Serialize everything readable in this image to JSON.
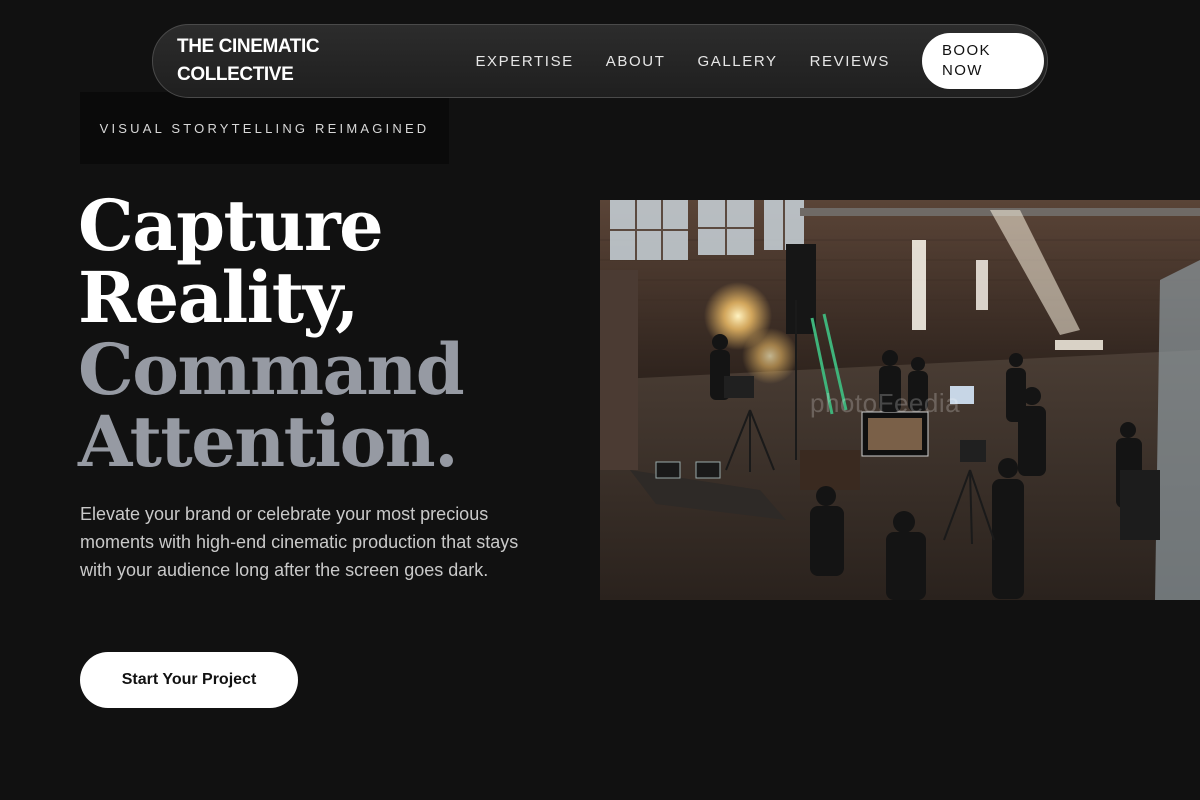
{
  "brand": {
    "name": "THE CINEMATIC\nCOLLECTIVE"
  },
  "nav": {
    "items": [
      {
        "label": "EXPERTISE"
      },
      {
        "label": "ABOUT"
      },
      {
        "label": "GALLERY"
      },
      {
        "label": "REVIEWS"
      }
    ],
    "cta_label": "BOOK\nNOW"
  },
  "hero": {
    "eyebrow": "VISUAL STORYTELLING REIMAGINED",
    "headline_lines": [
      "Capture",
      "Reality,",
      "Command",
      "Attention."
    ],
    "subcopy": "Elevate your brand or celebrate your most precious moments with high-end cinematic production that stays with your audience long after the screen goes dark.",
    "cta_label": "Start Your Project",
    "image": {
      "subject": "film crew on set in a brick warehouse studio",
      "watermark": "photoFeedia"
    }
  },
  "colors": {
    "background": "#111111",
    "accent_white": "#ffffff",
    "muted_headline": "#969aa3",
    "body_text": "#c9c9c9"
  }
}
